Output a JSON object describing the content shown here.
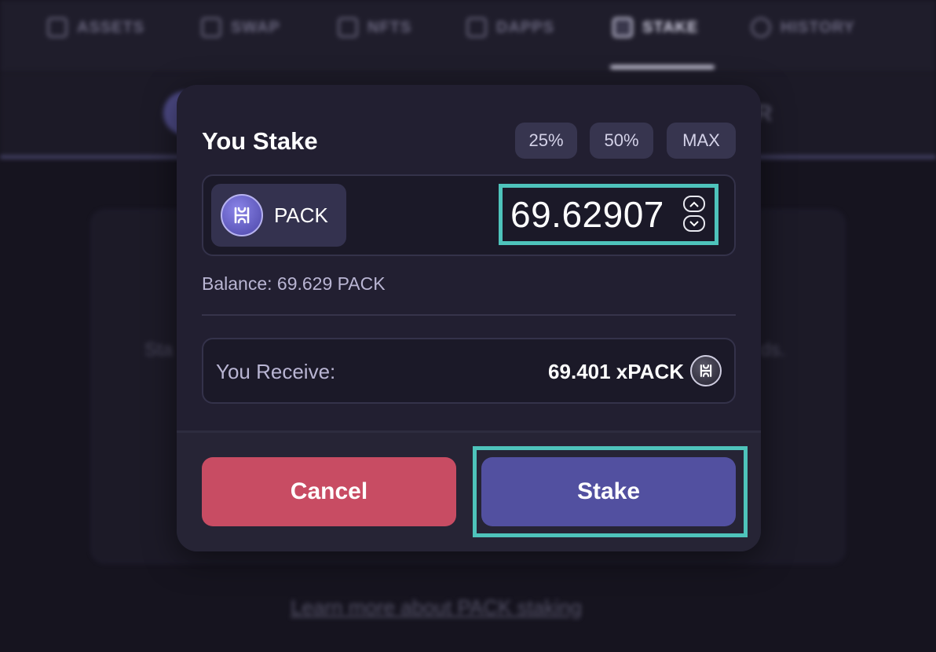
{
  "nav": {
    "items": [
      {
        "label": "ASSETS",
        "icon": "wallet-icon"
      },
      {
        "label": "SWAP",
        "icon": "swap-arrows-icon"
      },
      {
        "label": "NFTS",
        "icon": "grid-icon"
      },
      {
        "label": "DAPPS",
        "icon": "apps-icon"
      },
      {
        "label": "STAKE",
        "icon": "stake-icon",
        "active": true
      },
      {
        "label": "HISTORY",
        "icon": "history-icon"
      }
    ]
  },
  "background": {
    "tab_letter": "R",
    "card_text_left": "Sta",
    "card_text_right": "ds.",
    "learn_link": "Learn more about PACK staking"
  },
  "modal": {
    "title": "You Stake",
    "percent_buttons": [
      "25%",
      "50%",
      "MAX"
    ],
    "token": {
      "name": "PACK",
      "icon": "pack-token-icon"
    },
    "amount": "69.62907",
    "balance": "Balance: 69.629 PACK",
    "receive": {
      "label": "You Receive:",
      "value": "69.401 xPACK",
      "icon": "xpack-token-icon"
    },
    "cancel_label": "Cancel",
    "stake_label": "Stake"
  },
  "colors": {
    "accent_highlight": "#4ec3bb",
    "stake_button": "#5250a0",
    "cancel_button": "#c84c63",
    "modal_bg": "#221f31"
  }
}
